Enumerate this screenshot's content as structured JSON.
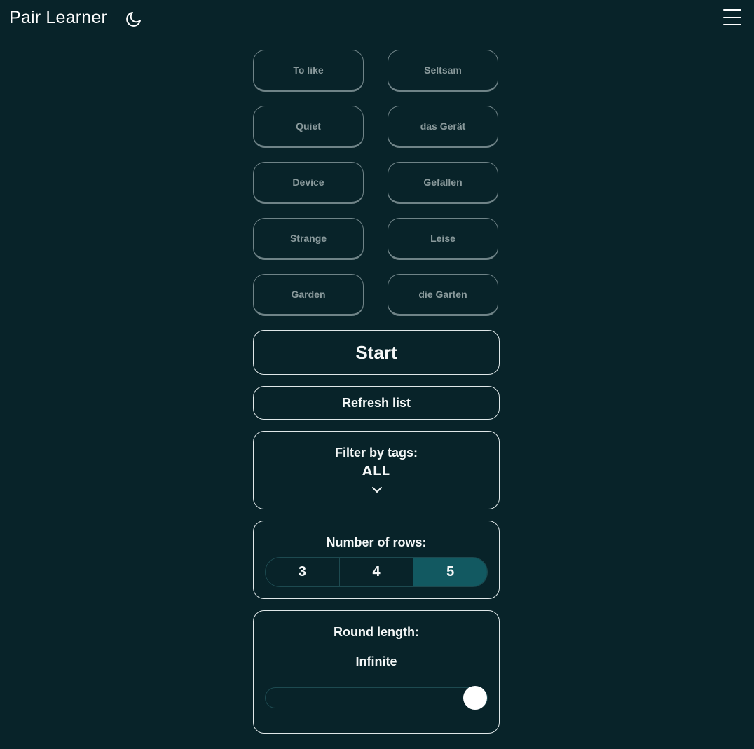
{
  "app": {
    "title": "Pair Learner",
    "theme_icon": "moon-icon",
    "menu_icon": "hamburger-menu-icon"
  },
  "pairs": [
    "To like",
    "Seltsam",
    "Quiet",
    "das Gerät",
    "Device",
    "Gefallen",
    "Strange",
    "Leise",
    "Garden",
    "die Garten"
  ],
  "actions": {
    "start_label": "Start",
    "refresh_label": "Refresh list"
  },
  "filter": {
    "label": "Filter by tags:",
    "value": "ALL",
    "icon": "chevron-down-icon"
  },
  "rows": {
    "label": "Number of rows:",
    "options": [
      "3",
      "4",
      "5"
    ],
    "selected": "5"
  },
  "round": {
    "label": "Round length:",
    "value": "Infinite",
    "slider_position": 1.0
  },
  "colors": {
    "background": "#082329",
    "active_segment": "#125961",
    "card_border": "#6f8387"
  }
}
